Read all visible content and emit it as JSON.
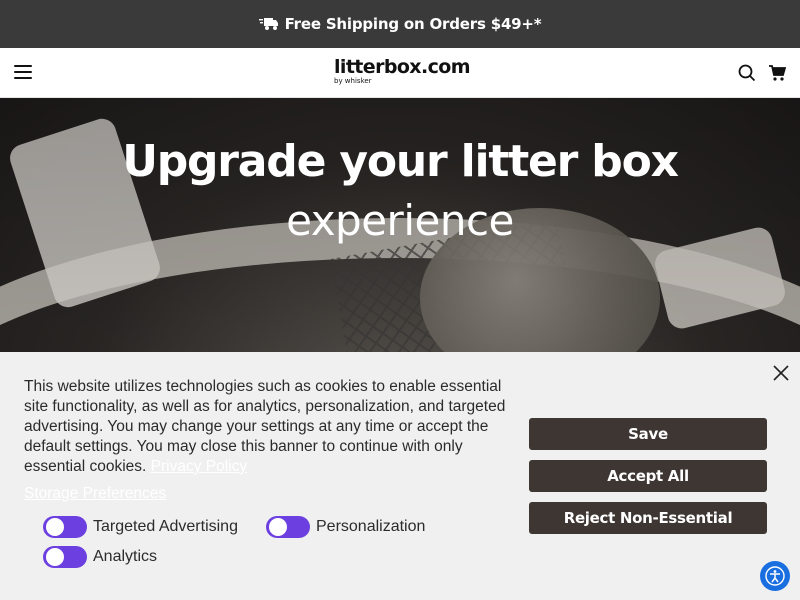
{
  "announcement": {
    "text": "Free Shipping on Orders $49+*",
    "icon": "truck-icon"
  },
  "header": {
    "logo_main": "litterbox.com",
    "logo_sub": "by whisker",
    "menu_icon": "hamburger-menu-icon",
    "search_icon": "search-icon",
    "cart_icon": "cart-icon"
  },
  "hero": {
    "title": "Upgrade your litter box",
    "subtitle": "experience"
  },
  "cookie_banner": {
    "message": "This website utilizes technologies such as cookies to enable essential site functionality, as well as for analytics, personalization, and targeted advertising. You may change your settings at any time or accept the default settings. You may close this banner to continue with only essential cookies. ",
    "privacy_link": "Privacy Policy",
    "storage_link": "Storage Preferences",
    "toggles": [
      {
        "label": "Targeted Advertising",
        "on": true
      },
      {
        "label": "Personalization",
        "on": true
      },
      {
        "label": "Analytics",
        "on": true
      }
    ],
    "buttons": {
      "save": "Save",
      "accept_all": "Accept All",
      "reject": "Reject Non-Essential"
    },
    "toggle_color": "#6b3fe0",
    "button_color": "#3d3633"
  },
  "accessibility_icon": "accessibility-icon"
}
